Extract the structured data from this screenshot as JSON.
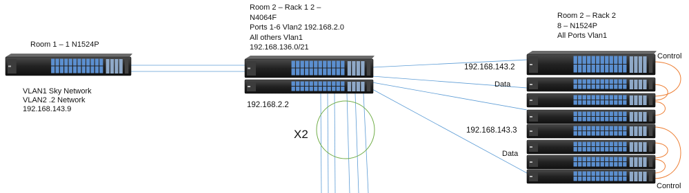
{
  "site_a": {
    "title": "Room  1 – 1 N1524P",
    "lines": [
      "VLAN1 Sky Network",
      "VLAN2 .2 Network",
      "192.168.143.9"
    ]
  },
  "rack1": {
    "lines": [
      "Room  2 – Rack 1  2 –",
      "N4064F",
      "Ports 1-6 Vlan2 192.168.2.0",
      "All others Vlan1",
      "192.168.136.0/21"
    ],
    "switch_ip": "192.168.2.2",
    "multiplier": "X2"
  },
  "rack2": {
    "lines": [
      "Room  2 – Rack 2",
      "8 – N1524P",
      "All Ports Vlan1"
    ],
    "group1": {
      "ip": "192.168.143.2",
      "data_label": "Data",
      "control_label": "Control"
    },
    "group2": {
      "ip": "192.168.143.3",
      "data_label": "Data",
      "control_label": "Control"
    }
  },
  "colors": {
    "link": "#5b9bd5",
    "stack": "#ed7d31",
    "uplink": "#70ad47",
    "chassis": "#2a2a2a",
    "port": "#5b8fd0"
  },
  "icons": [
    "network-switch-icon"
  ]
}
